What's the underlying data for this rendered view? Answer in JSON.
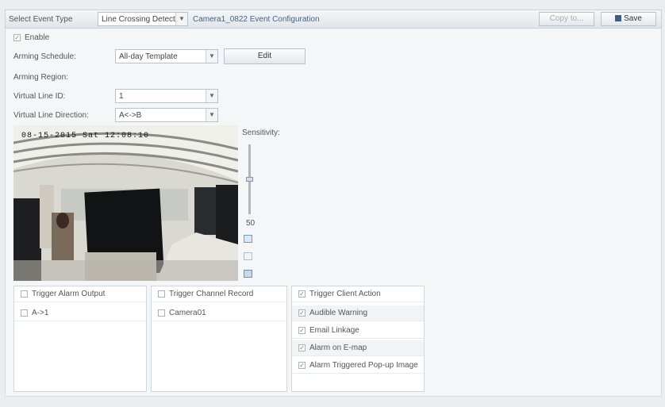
{
  "header": {
    "event_type_label": "Select Event Type",
    "event_type_value": "Line Crossing Detect...",
    "config_title": "Camera1_0822 Event Configuration",
    "copy_label": "Copy to...",
    "save_label": "Save"
  },
  "form": {
    "enable_label": "Enable",
    "arming_schedule_label": "Arming Schedule:",
    "arming_schedule_value": "All-day Template",
    "edit_label": "Edit",
    "arming_region_label": "Arming Region:",
    "virtual_line_id_label": "Virtual Line ID:",
    "virtual_line_id_value": "1",
    "virtual_line_direction_label": "Virtual Line Direction:",
    "virtual_line_direction_value": "A<->B"
  },
  "video": {
    "osd_text": "08-15-2015 Sat 12:08:10"
  },
  "sensitivity": {
    "label": "Sensitivity:",
    "value": "50",
    "level": 0.5
  },
  "linkage": {
    "alarm_output": {
      "header": "Trigger Alarm Output",
      "items": [
        "A->1"
      ]
    },
    "channel_record": {
      "header": "Trigger Channel Record",
      "items": [
        "Camera01"
      ]
    },
    "client_action": {
      "header": "Trigger Client Action",
      "items": [
        "Audible Warning",
        "Email Linkage",
        "Alarm on E-map",
        "Alarm Triggered Pop-up Image"
      ]
    }
  },
  "colors": {
    "accent": "#4a7db8",
    "check": "#6a8a3a"
  }
}
